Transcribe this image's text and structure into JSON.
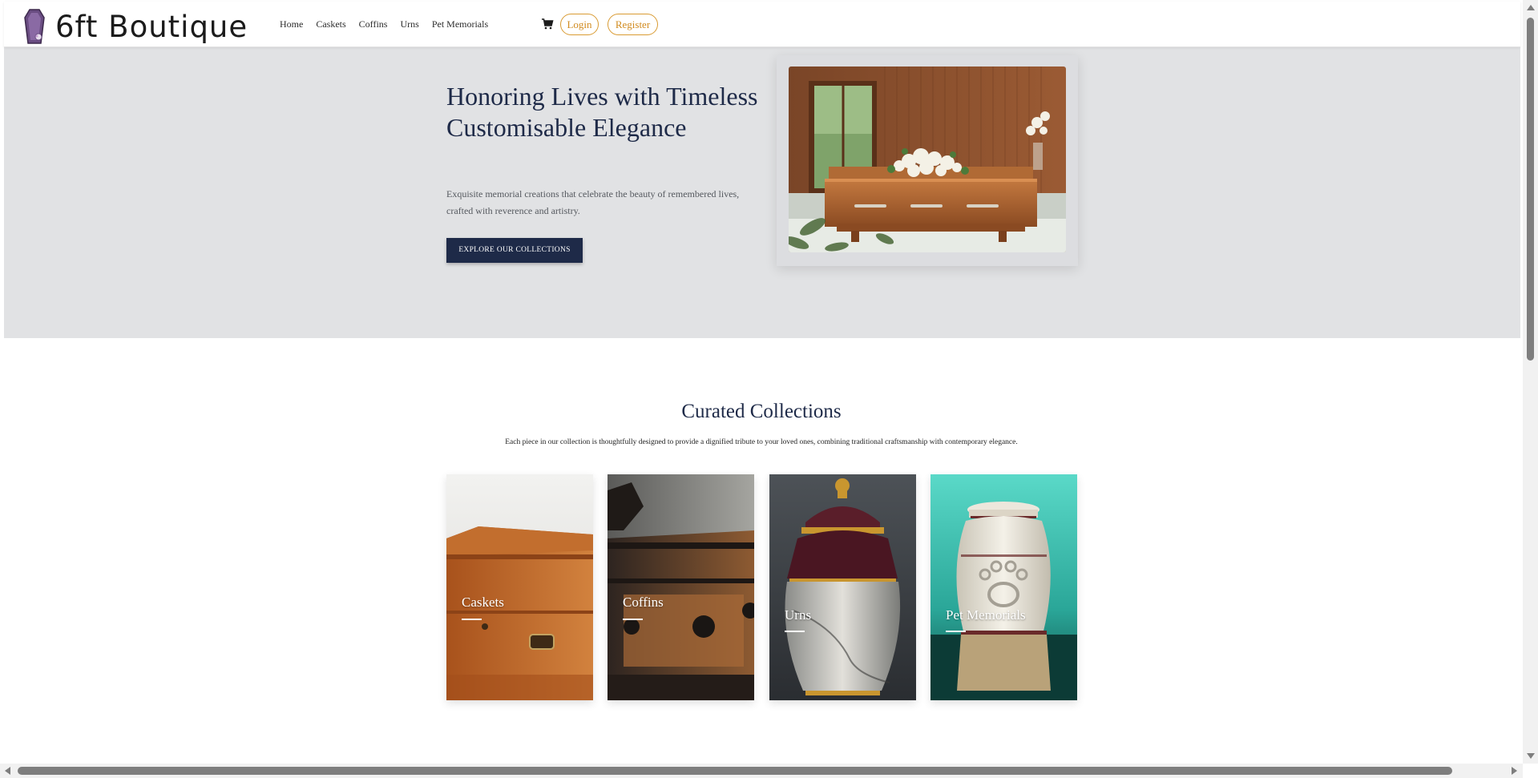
{
  "brand": {
    "name": "6ft Boutique"
  },
  "nav": {
    "items": [
      "Home",
      "Caskets",
      "Coffins",
      "Urns",
      "Pet Memorials"
    ],
    "login_label": "Login",
    "register_label": "Register",
    "accent_color": "#d99b33"
  },
  "hero": {
    "title": "Honoring Lives with Timeless Customisable Elegance",
    "subtitle": "Exquisite memorial creations that celebrate the beauty of remembered lives, crafted with reverence and artistry.",
    "cta_label": "EXPLORE OUR COLLECTIONS",
    "background_color": "#e1e2e4",
    "primary_color": "#1e2a48"
  },
  "collections": {
    "title": "Curated Collections",
    "subtitle": "Each piece in our collection is thoughtfully designed to provide a dignified tribute to your loved ones, combining traditional craftsmanship with contemporary elegance.",
    "cards": [
      {
        "label": "Caskets",
        "image": "wooden-casket"
      },
      {
        "label": "Coffins",
        "image": "carved-coffin"
      },
      {
        "label": "Urns",
        "image": "marble-urn"
      },
      {
        "label": "Pet Memorials",
        "image": "paw-print-urn"
      }
    ]
  }
}
